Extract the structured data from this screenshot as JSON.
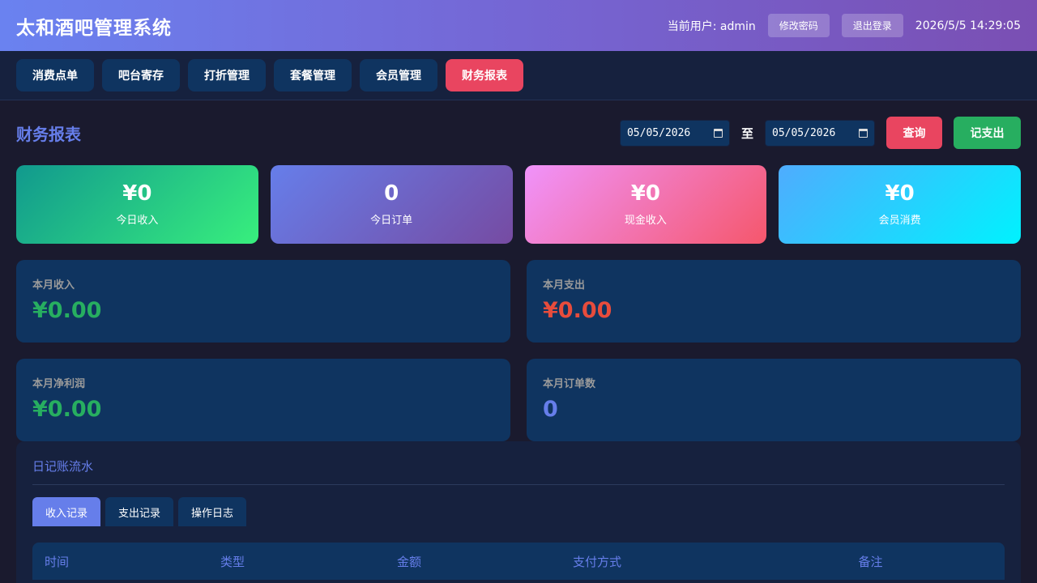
{
  "header": {
    "title": "太和酒吧管理系统",
    "current_user": "当前用户: admin",
    "change_password": "修改密码",
    "logout": "退出登录",
    "datetime": "2026/5/5 14:29:05"
  },
  "nav": {
    "tabs": [
      {
        "label": "消费点单"
      },
      {
        "label": "吧台寄存"
      },
      {
        "label": "打折管理"
      },
      {
        "label": "套餐管理"
      },
      {
        "label": "会员管理"
      },
      {
        "label": "财务报表",
        "active": true
      }
    ]
  },
  "page": {
    "title": "财务报表",
    "date_from": "05/05/2026",
    "to_label": "至",
    "date_to": "05/05/2026",
    "query_label": "查询",
    "record_expense_label": "记支出"
  },
  "stats": [
    {
      "value": "¥0",
      "label": "今日收入"
    },
    {
      "value": "0",
      "label": "今日订单"
    },
    {
      "value": "¥0",
      "label": "现金收入"
    },
    {
      "value": "¥0",
      "label": "会员消费"
    }
  ],
  "monthly": [
    {
      "label": "本月收入",
      "value": "¥0.00",
      "color": "#27ae60"
    },
    {
      "label": "本月支出",
      "value": "¥0.00",
      "color": "#e74c3c"
    },
    {
      "label": "本月净利润",
      "value": "¥0.00",
      "color": "#27ae60"
    },
    {
      "label": "本月订单数",
      "value": "0",
      "color": "#667eea"
    }
  ],
  "ledger": {
    "title": "日记账流水",
    "tabs": [
      {
        "label": "收入记录",
        "active": true
      },
      {
        "label": "支出记录"
      },
      {
        "label": "操作日志"
      }
    ],
    "columns": [
      "时间",
      "类型",
      "金额",
      "支付方式",
      "备注"
    ]
  },
  "colors": {
    "accent": "#667eea",
    "danger": "#e94560",
    "success": "#27ae60",
    "panel": "#0f3460",
    "background": "#1a1a2e"
  }
}
